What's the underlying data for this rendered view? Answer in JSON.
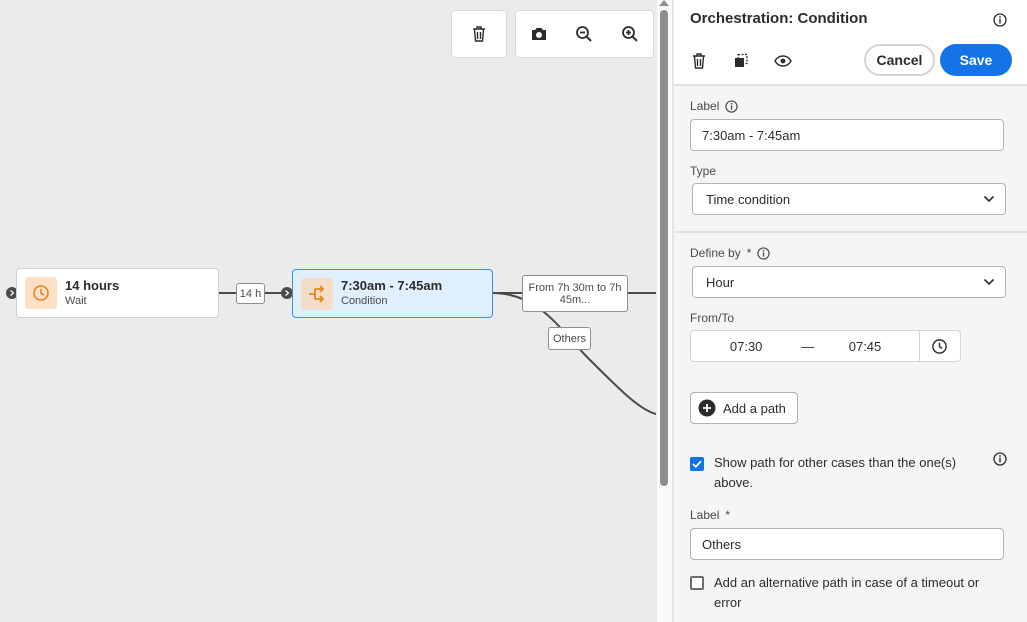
{
  "canvas": {
    "nodes": [
      {
        "title": "14 hours",
        "subtitle": "Wait",
        "icon": "clock-icon"
      },
      {
        "title": "7:30am - 7:45am",
        "subtitle": "Condition",
        "icon": "condition-icon"
      }
    ],
    "edge_labels": {
      "wait_duration": "14 h",
      "path_main": "From 7h 30m  to 7h 45m...",
      "path_others": "Others"
    }
  },
  "panel": {
    "title": "Orchestration: Condition",
    "cancel_label": "Cancel",
    "save_label": "Save",
    "label_field": {
      "label": "Label",
      "value": "7:30am - 7:45am"
    },
    "type_field": {
      "label": "Type",
      "value": "Time condition"
    },
    "define_by": {
      "label": "Define by",
      "required_mark": "*",
      "value": "Hour"
    },
    "from_to": {
      "label": "From/To",
      "from": "07:30",
      "separator": "—",
      "to": "07:45"
    },
    "add_path_label": "Add a path",
    "show_other_path": {
      "checked": true,
      "text": "Show path for other cases than the one(s) above."
    },
    "other_label_field": {
      "label": "Label",
      "required_mark": "*",
      "value": "Others"
    },
    "timeout_path": {
      "checked": false,
      "text": "Add an alternative path in case of a timeout or error"
    }
  },
  "colors": {
    "accent": "#1473e6",
    "selected_node_bg": "#e0effd",
    "icon_orange": "#e68619"
  }
}
